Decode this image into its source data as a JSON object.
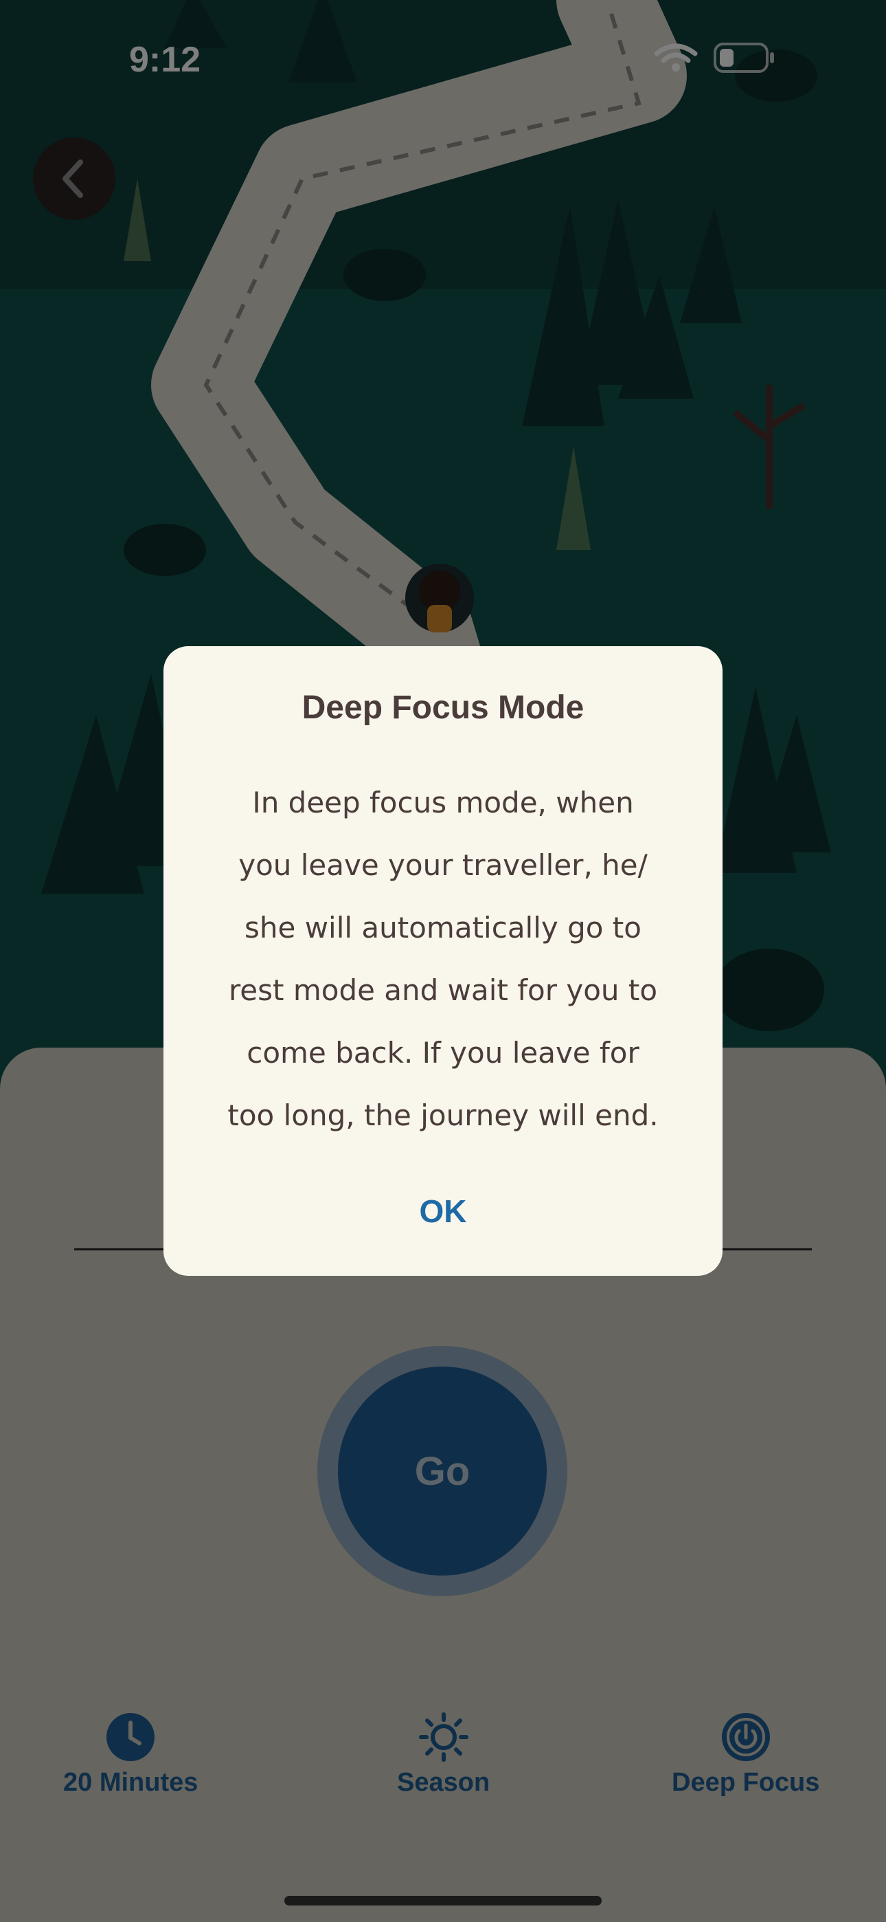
{
  "status_bar": {
    "time": "9:12"
  },
  "dialog": {
    "title": "Deep Focus Mode",
    "body_lines": [
      "In deep focus mode, when",
      "you leave your traveller, he/",
      "she will automatically go to",
      "rest mode and wait for you to",
      "come back. If you leave for",
      "too long, the journey will end."
    ],
    "ok_label": "OK"
  },
  "controls": {
    "go_label": "Go",
    "options": [
      {
        "label": "20 Minutes",
        "icon": "clock-icon"
      },
      {
        "label": "Season",
        "icon": "sun-icon"
      },
      {
        "label": "Deep Focus",
        "icon": "deep-focus-icon"
      }
    ]
  },
  "colors": {
    "accent": "#1e5d92",
    "forest": "#0f3d3c",
    "path": "#d8d5cc",
    "dialog_bg": "#f9f6ec",
    "text": "#4a3c3a"
  }
}
